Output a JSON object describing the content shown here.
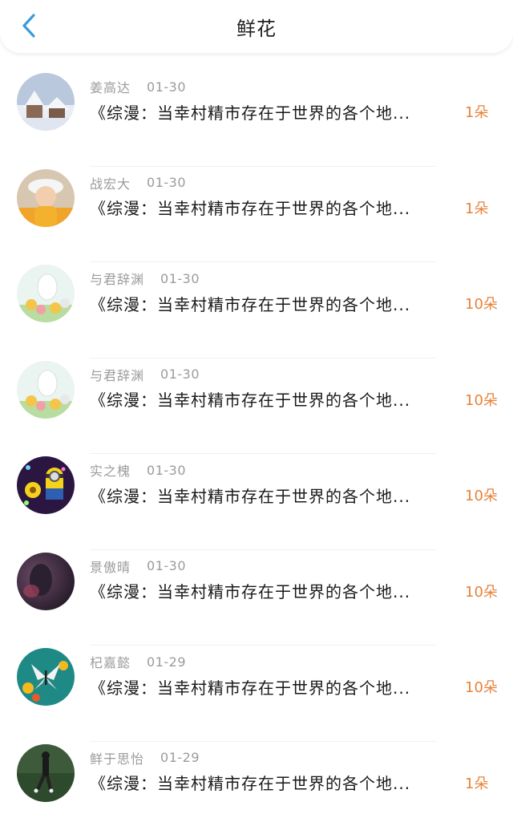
{
  "header": {
    "title": "鲜花",
    "back_icon": "chevron-left-icon",
    "accent_color": "#3a9bdc"
  },
  "records": [
    {
      "name": "姜高达",
      "date": "01-30",
      "message": "《综漫：当幸村精市存在于世界的各个地...",
      "count": "1朵",
      "avatar": "snow-house"
    },
    {
      "name": "战宏大",
      "date": "01-30",
      "message": "《综漫：当幸村精市存在于世界的各个地...",
      "count": "1朵",
      "avatar": "child-photo"
    },
    {
      "name": "与君辞渊",
      "date": "01-30",
      "message": "《综漫：当幸村精市存在于世界的各个地...",
      "count": "10朵",
      "avatar": "cartoon-birds"
    },
    {
      "name": "与君辞渊",
      "date": "01-30",
      "message": "《综漫：当幸村精市存在于世界的各个地...",
      "count": "10朵",
      "avatar": "cartoon-birds"
    },
    {
      "name": "实之槐",
      "date": "01-30",
      "message": "《综漫：当幸村精市存在于世界的各个地...",
      "count": "10朵",
      "avatar": "minion"
    },
    {
      "name": "景傲晴",
      "date": "01-30",
      "message": "《综漫：当幸村精市存在于世界的各个地...",
      "count": "10朵",
      "avatar": "dark-portrait"
    },
    {
      "name": "杞嘉懿",
      "date": "01-29",
      "message": "《综漫：当幸村精市存在于世界的各个地...",
      "count": "10朵",
      "avatar": "butterfly-flowers"
    },
    {
      "name": "鲜于思怡",
      "date": "01-29",
      "message": "《综漫：当幸村精市存在于世界的各个地...",
      "count": "1朵",
      "avatar": "person-on-grass"
    }
  ],
  "colors": {
    "count": "#e8823a",
    "name": "#9b9b9b",
    "message": "#1a1a1a"
  }
}
